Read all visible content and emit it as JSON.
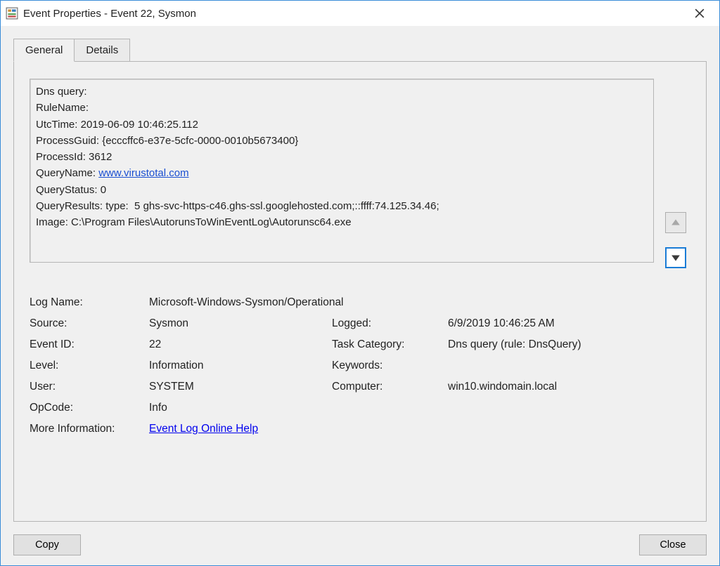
{
  "window": {
    "title": "Event Properties - Event 22, Sysmon"
  },
  "tabs": {
    "general": "General",
    "details": "Details"
  },
  "event_body": {
    "line1": "Dns query:",
    "line2": "RuleName:",
    "line3": "UtcTime: 2019-06-09 10:46:25.112",
    "line4": "ProcessGuid: {ecccffc6-e37e-5cfc-0000-0010b5673400}",
    "line5": "ProcessId: 3612",
    "queryname_label": "QueryName: ",
    "queryname_link": "www.virustotal.com",
    "line7": "QueryStatus: 0",
    "line8": "QueryResults: type:  5 ghs-svc-https-c46.ghs-ssl.googlehosted.com;::ffff:74.125.34.46;",
    "line9": "Image: C:\\Program Files\\AutorunsToWinEventLog\\Autorunsc64.exe"
  },
  "props": {
    "log_name_label": "Log Name:",
    "log_name": "Microsoft-Windows-Sysmon/Operational",
    "source_label": "Source:",
    "source": "Sysmon",
    "logged_label": "Logged:",
    "logged": "6/9/2019 10:46:25 AM",
    "event_id_label": "Event ID:",
    "event_id": "22",
    "task_category_label": "Task Category:",
    "task_category": "Dns query (rule: DnsQuery)",
    "level_label": "Level:",
    "level": "Information",
    "keywords_label": "Keywords:",
    "keywords": "",
    "user_label": "User:",
    "user": "SYSTEM",
    "computer_label": "Computer:",
    "computer": "win10.windomain.local",
    "opcode_label": "OpCode:",
    "opcode": "Info",
    "more_info_label": "More Information:",
    "more_info_link": "Event Log Online Help"
  },
  "buttons": {
    "copy": "Copy",
    "close": "Close"
  }
}
